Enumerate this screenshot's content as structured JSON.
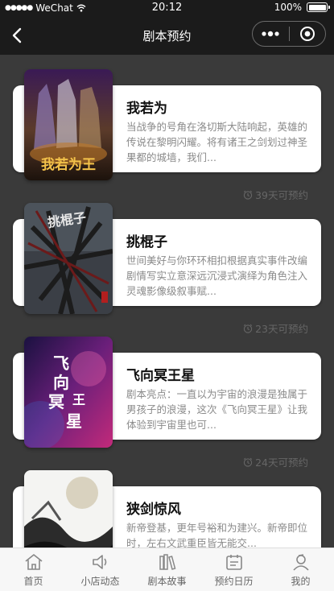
{
  "status_bar": {
    "carrier": "WeChat",
    "time": "20:12",
    "battery": "100%"
  },
  "nav": {
    "title": "剧本预约"
  },
  "scripts": [
    {
      "title": "我若为",
      "description": "当战争的号角在洛切斯大陆响起，英雄的传说在黎明闪耀。将有诸王之剑划过神圣果都的城墙，我们...",
      "days": "39天可预约",
      "poster_text": "我若为王"
    },
    {
      "title": "挑棍子",
      "description": "世间美好与你环环相扣根据真实事件改编剧情写实立意深远沉浸式演绎为角色注入灵魂影像级叙事赋...",
      "days": "23天可预约",
      "poster_text": "挑棍子"
    },
    {
      "title": "飞向冥王星",
      "description": "剧本亮点：一直以为宇宙的浪漫是独属于男孩子的浪漫，这次《飞向冥王星》让我体验到宇宙里也可...",
      "days": "24天可预约",
      "poster_text": "飞向冥王星"
    },
    {
      "title": "狭剑惊风",
      "description": "新帝登基，更年号裕和为建兴。新帝即位时，左右文武重臣皆无能交...",
      "days": "",
      "poster_text": ""
    }
  ],
  "tabs": [
    {
      "label": "首页",
      "icon": "home-icon"
    },
    {
      "label": "小店动态",
      "icon": "speaker-icon"
    },
    {
      "label": "剧本故事",
      "icon": "books-icon"
    },
    {
      "label": "预约日历",
      "icon": "calendar-icon"
    },
    {
      "label": "我的",
      "icon": "user-icon"
    }
  ],
  "colors": {
    "nav_background": "#1b1b1b",
    "page_background": "#3a3a3a",
    "card_background": "#ffffff",
    "description_text": "#8a8a8a",
    "tab_bar_background": "#f7f7f7"
  }
}
